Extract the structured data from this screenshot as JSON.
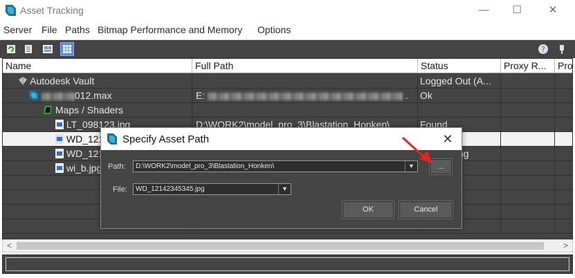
{
  "window": {
    "title": "Asset Tracking",
    "icon": "3dsmax-app-icon",
    "controls": {
      "minimize": "—",
      "maximize": "☐",
      "close": "✕"
    }
  },
  "menu": [
    "Server",
    "File",
    "Paths",
    "Bitmap Performance and Memory",
    "Options"
  ],
  "toolbar": {
    "buttons": [
      "refresh-icon",
      "list-icon",
      "thumbnail-icon",
      "table-view-icon"
    ],
    "help_icon": "help-icon"
  },
  "grid": {
    "columns": [
      "Name",
      "Full Path",
      "Status",
      "Proxy R...",
      "Pro"
    ],
    "rows": [
      {
        "name": "Autodesk Vault",
        "path": "",
        "status": "Logged Out (A...",
        "icon": "vault-icon"
      },
      {
        "name": "012.max",
        "path": "E:",
        "path_tail": ".",
        "status": "Ok",
        "icon": "max-file-icon"
      },
      {
        "name": "Maps / Shaders",
        "path": "",
        "status": "",
        "icon": "maps-shaders-icon"
      },
      {
        "name": "LT_098123.jpg",
        "path": "D:\\WORK2\\model_pro_3\\Blastation_Honken\\",
        "status": "Found",
        "icon": "image-file-icon"
      },
      {
        "name": "WD_121",
        "path": "",
        "status": "",
        "icon": "image-file-icon",
        "selected": true
      },
      {
        "name": "WD_121",
        "path": "",
        "status": "ng",
        "icon": "image-file-icon"
      },
      {
        "name": "wi_b.jpg",
        "path": "",
        "status": "",
        "icon": "image-file-icon"
      }
    ]
  },
  "scrollbar": {
    "left": "<",
    "right": ">"
  },
  "dialog": {
    "title": "Specify Asset Path",
    "path_label": "Path:",
    "path_value": "D:\\WORK2\\model_pro_3\\Blastation_Honken\\",
    "browse_label": "...",
    "file_label": "File:",
    "file_value": "WD_12142345345.jpg",
    "ok": "OK",
    "cancel": "Cancel",
    "close": "✕"
  },
  "colors": {
    "panel": "#444444",
    "header": "#ffffff",
    "selection": "#f2f2f2",
    "annotation": "#e8231d"
  }
}
